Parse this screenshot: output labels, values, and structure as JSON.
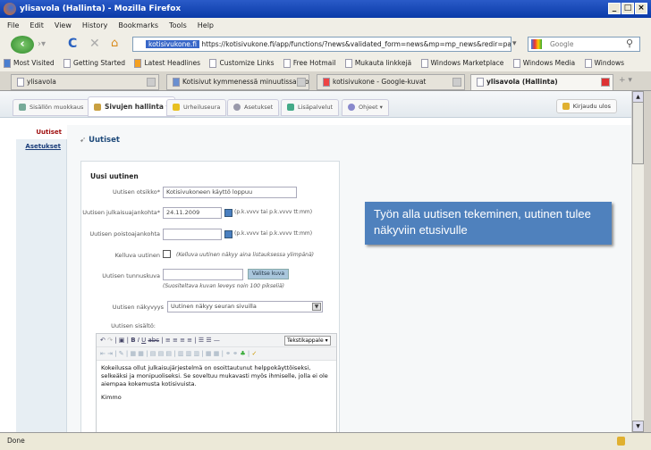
{
  "window": {
    "title": "ylisavola (Hallinta) - Mozilla Firefox"
  },
  "menu": [
    "File",
    "Edit",
    "View",
    "History",
    "Bookmarks",
    "Tools",
    "Help"
  ],
  "nav": {
    "site_label": "kotisivukone.fi",
    "url": "https://kotisivukone.fi/app/functions/?news&validated_form=news&mp=mp_news&redir=page",
    "search_placeholder": "Google"
  },
  "bookmarks": [
    "Most Visited",
    "Getting Started",
    "Latest Headlines",
    "Customize Links",
    "Free Hotmail",
    "Mukauta linkkejä",
    "Windows Marketplace",
    "Windows Media",
    "Windows"
  ],
  "browser_tabs": [
    "ylisavola",
    "Kotisivut kymmenessä minuutissa. Ko...",
    "kotisivukone - Google-kuvat",
    "ylisavola (Hallinta)"
  ],
  "app_tabs": [
    "Sisällön muokkaus",
    "Sivujen hallinta",
    "Urheiluseura",
    "Asetukset",
    "Lisäpalvelut",
    "Ohjeet"
  ],
  "logout": "Kirjaudu ulos",
  "sidebar": [
    "Uutiset",
    "Asetukset"
  ],
  "heading": "Uutiset",
  "form": {
    "title": "Uusi uutinen",
    "title_label": "Uutisen otsikko*",
    "title_value": "Kotisivukoneen käyttö loppuu",
    "pub_label": "Uutisen julkaisuajankohta*",
    "pub_value": "24.11.2009",
    "date_hint": "(p.k.vvvv tai p.k.vvvv tt:mm)",
    "del_label": "Uutisen poistoajankohta",
    "del_value": "",
    "float_label": "Kelluva uutinen",
    "float_note": "(Kelluva uutinen näkyy aina listauksessa ylimpänä)",
    "image_label": "Uutisen tunnuskuva",
    "image_button": "Valitse kuva",
    "image_note": "(Suositeltava kuvan leveys noin 100 pikseliä)",
    "vis_label": "Uutisen näkyvyys",
    "vis_value": "Uutinen näkyy seuran sivuilla",
    "content_label": "Uutisen sisältö:",
    "format_select": "Tekstikappale",
    "content_p1": "Kokeilussa ollut julkaisujärjestelmä on osoittautunut helppokäyttöiseksi, selkeäksi ja monipuoliseksi. Se soveltuu mukavasti myös ihmiselle, jolla ei ole aiempaa kokemusta kotisivuista.",
    "content_p2": "Kimmo"
  },
  "callout": "Työn alla uutisen tekeminen, uutinen tulee näkyviin etusivulle",
  "status": "Done"
}
